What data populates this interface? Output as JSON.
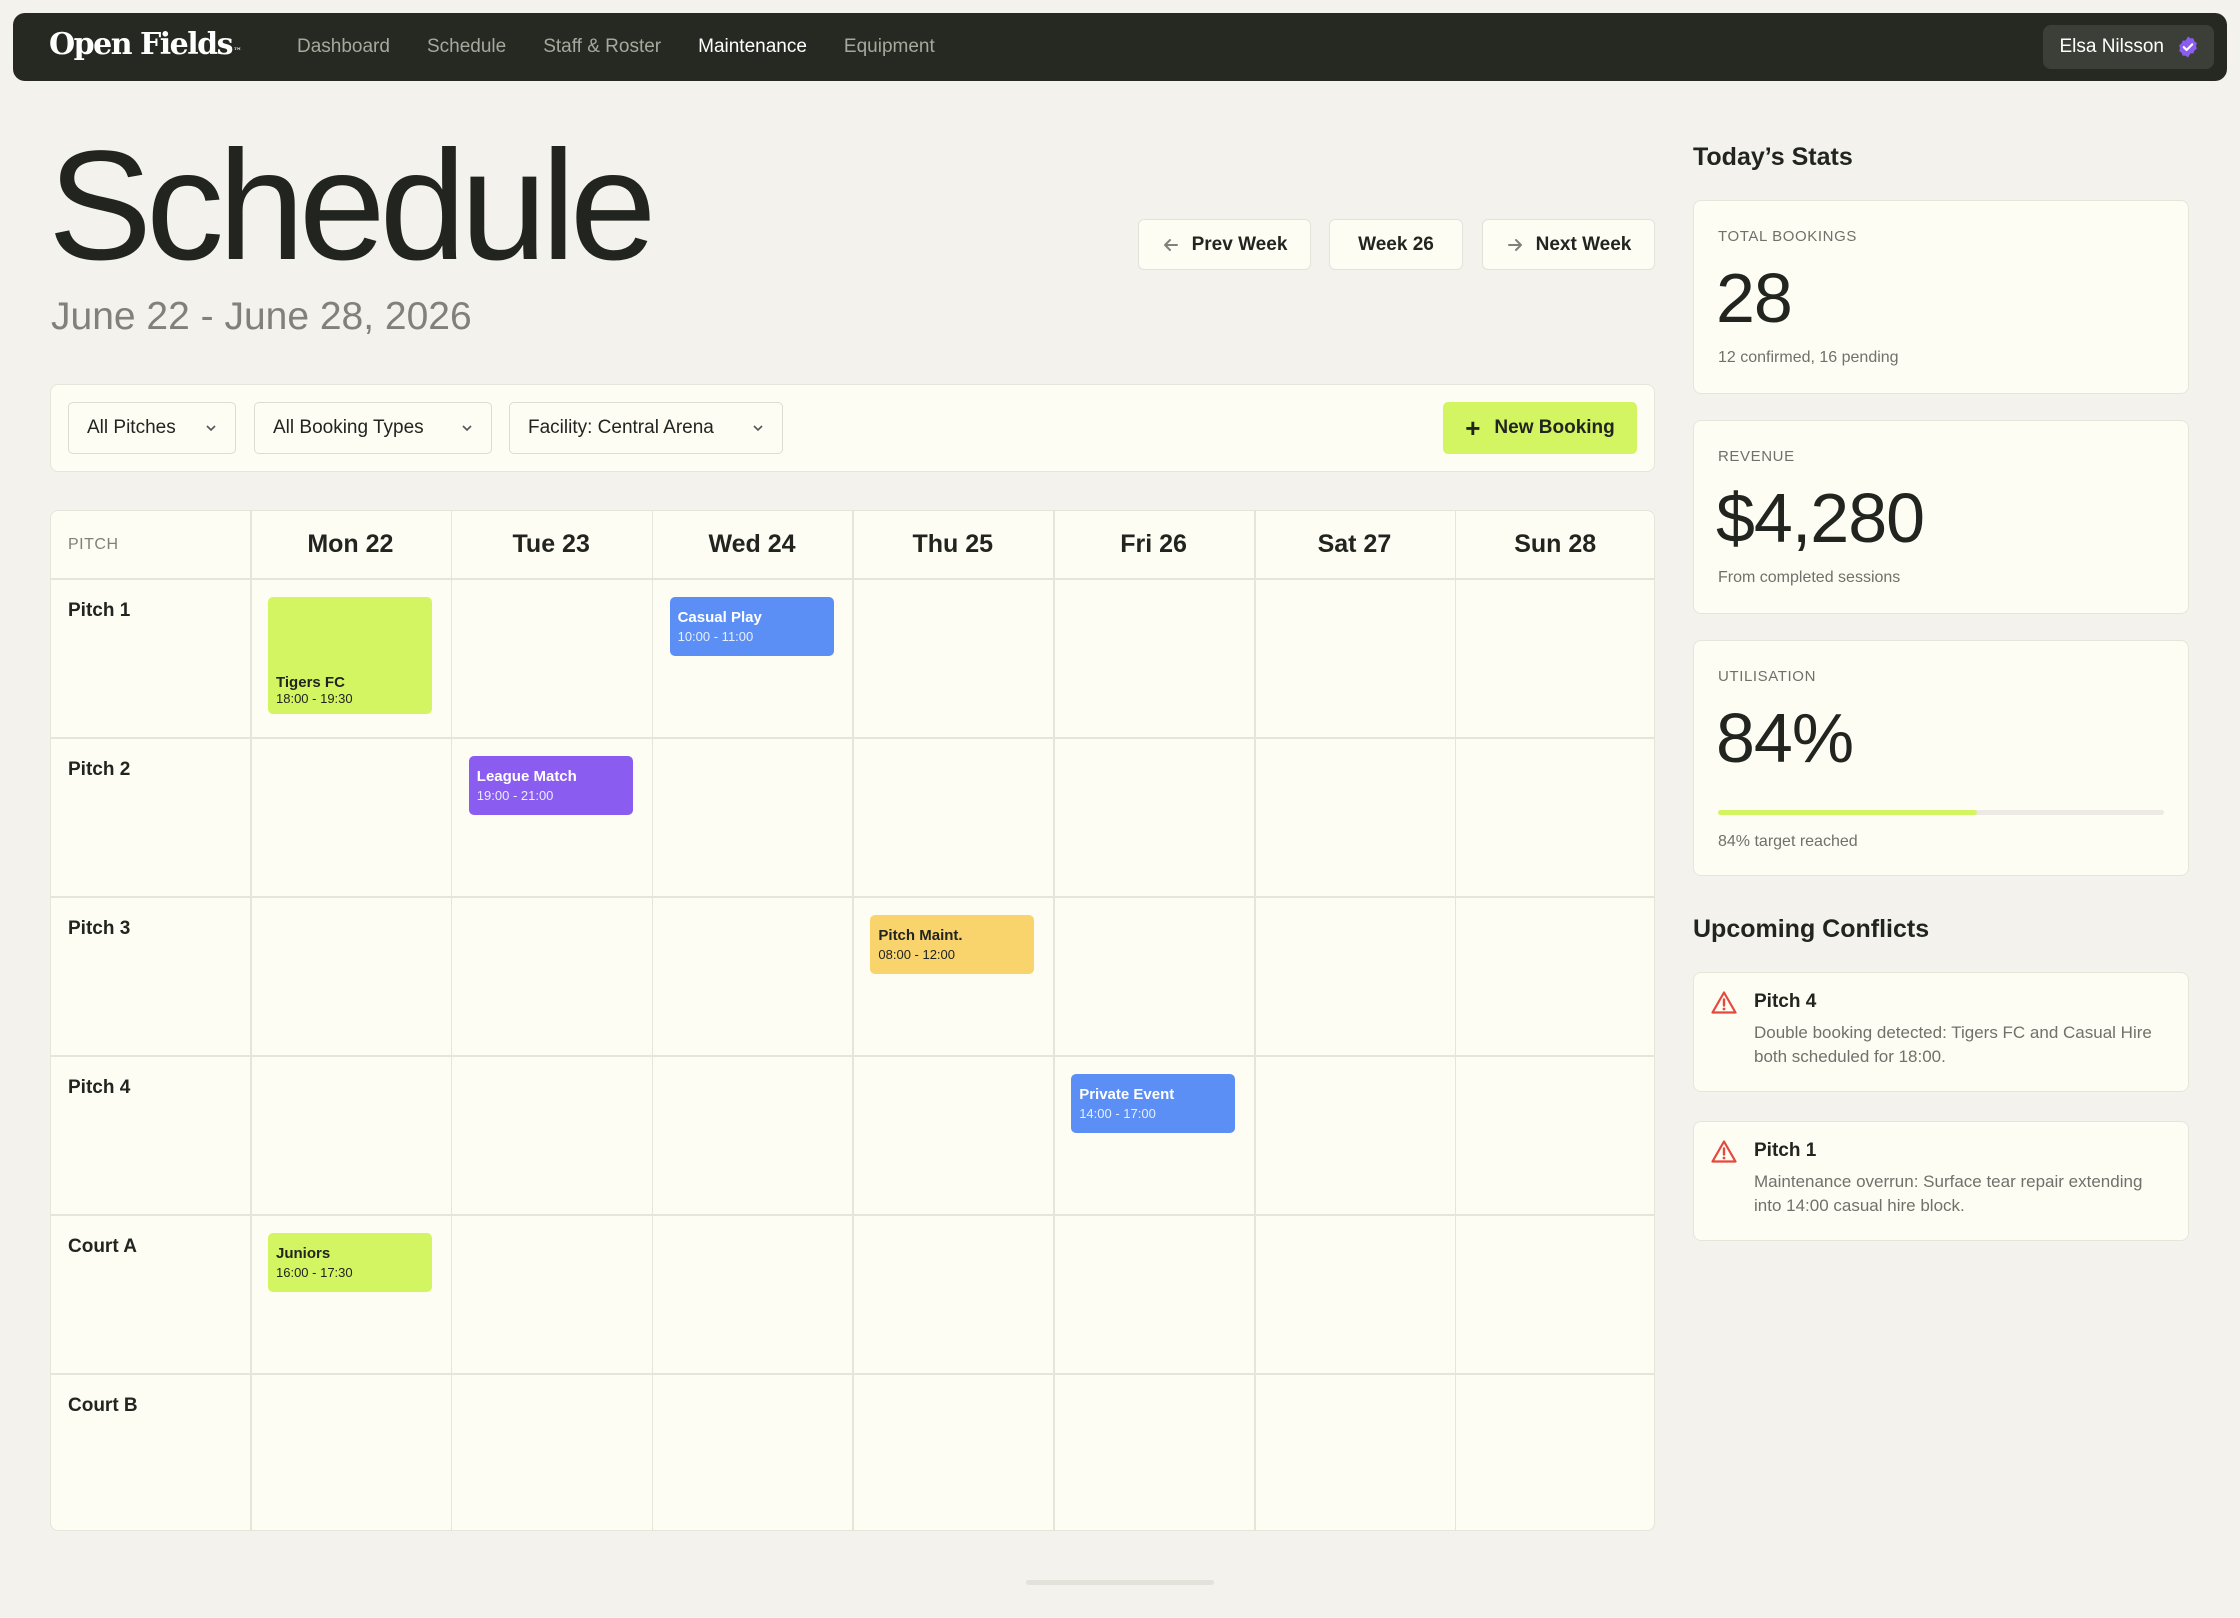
{
  "nav": {
    "logo": "Open Fields",
    "logo_mark": "™",
    "links": [
      "Dashboard",
      "Schedule",
      "Staff & Roster",
      "Maintenance",
      "Equipment"
    ],
    "active_link": "Maintenance",
    "user_name": "Elsa Nilsson",
    "user_badge_color": "#8a5cf0"
  },
  "header": {
    "title": "Schedule",
    "date_range": "June 22 - June 28, 2026",
    "prev_week": "Prev Week",
    "week_label": "Week 26",
    "next_week": "Next Week"
  },
  "filters": {
    "pitches": "All Pitches",
    "booking_types": "All Booking Types",
    "facility": "Facility: Central Arena",
    "new_booking": "New Booking"
  },
  "grid": {
    "pitch_header": "PITCH",
    "days": [
      "Mon 22",
      "Tue 23",
      "Wed 24",
      "Thu 25",
      "Fri 26",
      "Sat 27",
      "Sun 28"
    ],
    "rows": [
      "Pitch 1",
      "Pitch 2",
      "Pitch 3",
      "Pitch 4",
      "Court A",
      "Court B"
    ],
    "bookings": [
      {
        "title": "Tigers FC",
        "time": "18:00 - 19:30",
        "row": "Pitch 1",
        "day": "Mon 22",
        "color": "#d4f562"
      },
      {
        "title": "Casual Play",
        "time": "10:00 - 11:00",
        "row": "Pitch 1",
        "day": "Wed 24",
        "color": "#5b8ff5"
      },
      {
        "title": "League Match",
        "time": "19:00 - 21:00",
        "row": "Pitch 2",
        "day": "Tue 23",
        "color": "#8a5cf0"
      },
      {
        "title": "Pitch Maint.",
        "time": "08:00 - 12:00",
        "row": "Pitch 3",
        "day": "Thu 25",
        "color": "#f9d36c"
      },
      {
        "title": "Private Event",
        "time": "14:00 - 17:00",
        "row": "Pitch 4",
        "day": "Fri 26",
        "color": "#5b8ff5"
      },
      {
        "title": "Juniors",
        "time": "16:00 - 17:30",
        "row": "Court A",
        "day": "Mon 22",
        "color": "#d4f562"
      }
    ]
  },
  "stats": {
    "section_title": "Today’s Stats",
    "total_bookings": {
      "label": "TOTAL BOOKINGS",
      "value": "28",
      "sub": "12 confirmed, 16 pending"
    },
    "revenue": {
      "label": "REVENUE",
      "value": "$4,280",
      "sub": "From completed sessions"
    },
    "utilisation": {
      "label": "UTILISATION",
      "value": "84%",
      "sub": "84% target reached",
      "progress": 0.58
    }
  },
  "conflicts": {
    "section_title": "Upcoming Conflicts",
    "items": [
      {
        "title": "Pitch 4",
        "desc": "Double booking detected: Tigers FC and Casual Hire both scheduled for 18:00."
      },
      {
        "title": "Pitch 1",
        "desc": "Maintenance overrun: Surface tear repair extending into 14:00 casual hire block."
      }
    ],
    "warn_color": "#e5483d"
  }
}
